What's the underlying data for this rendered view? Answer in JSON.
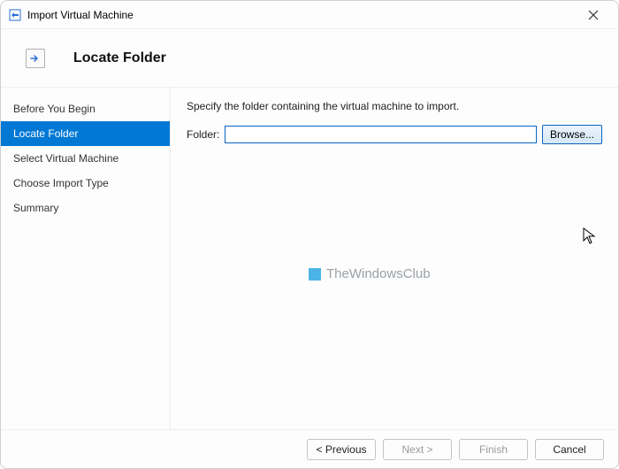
{
  "window": {
    "title": "Import Virtual Machine"
  },
  "header": {
    "title": "Locate Folder"
  },
  "sidebar": {
    "items": [
      {
        "label": "Before You Begin"
      },
      {
        "label": "Locate Folder"
      },
      {
        "label": "Select Virtual Machine"
      },
      {
        "label": "Choose Import Type"
      },
      {
        "label": "Summary"
      }
    ],
    "active_index": 1
  },
  "content": {
    "instruction": "Specify the folder containing the virtual machine to import.",
    "folder_label": "Folder:",
    "folder_value": "",
    "browse_label": "Browse..."
  },
  "footer": {
    "previous": "< Previous",
    "next": "Next >",
    "finish": "Finish",
    "cancel": "Cancel"
  },
  "watermark": {
    "text": "TheWindowsClub"
  }
}
